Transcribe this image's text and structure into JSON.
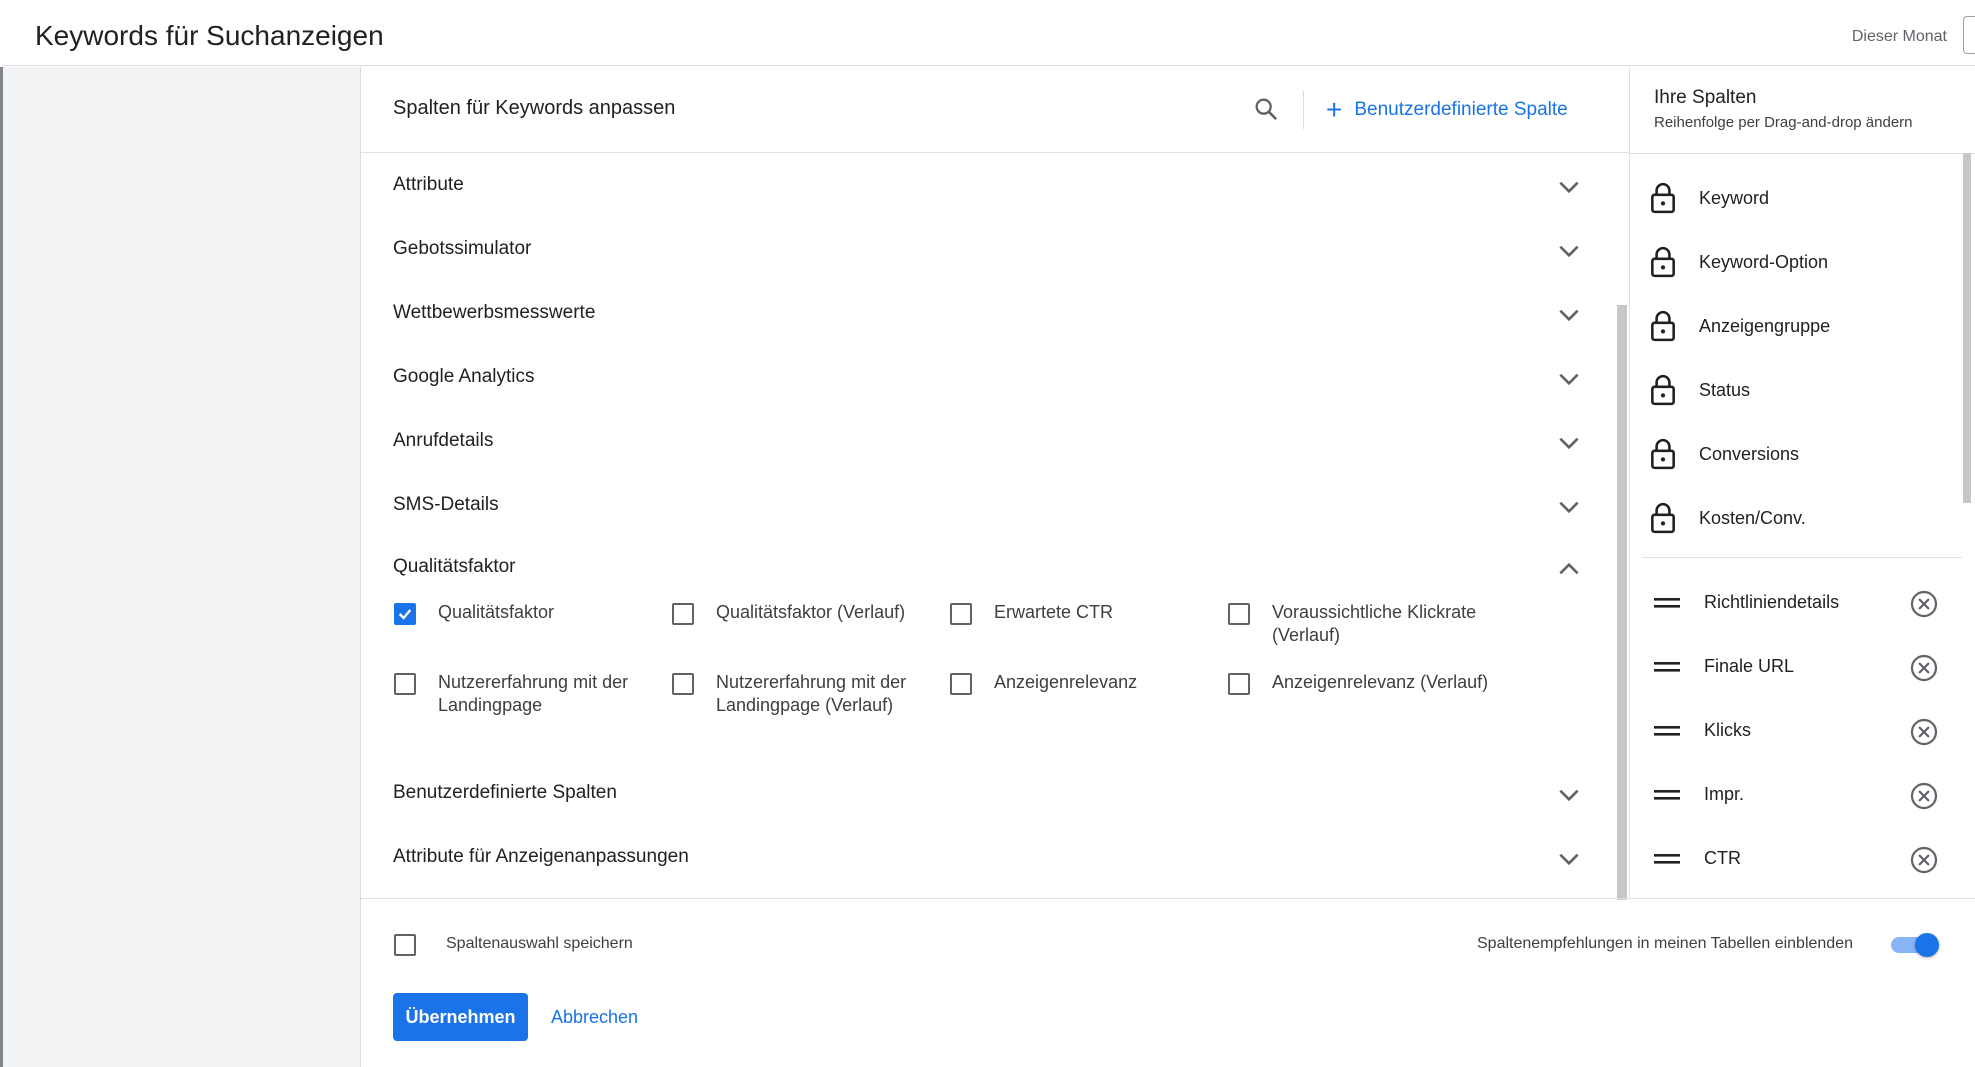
{
  "page": {
    "title": "Keywords für Suchanzeigen",
    "period_label": "Dieser Monat"
  },
  "dialog": {
    "title": "Spalten für Keywords anpassen",
    "custom_column_button": "Benutzerdefinierte Spalte",
    "sections": [
      {
        "label": "Attribute",
        "expanded": false
      },
      {
        "label": "Gebotssimulator",
        "expanded": false
      },
      {
        "label": "Wettbewerbsmesswerte",
        "expanded": false
      },
      {
        "label": "Google Analytics",
        "expanded": false
      },
      {
        "label": "Anrufdetails",
        "expanded": false
      },
      {
        "label": "SMS-Details",
        "expanded": false
      },
      {
        "label": "Qualitätsfaktor",
        "expanded": true
      },
      {
        "label": "Benutzerdefinierte Spalten",
        "expanded": false
      },
      {
        "label": "Attribute für Anzeigenanpassungen",
        "expanded": false
      }
    ],
    "quality_options": [
      {
        "label": "Qualitätsfaktor",
        "checked": true
      },
      {
        "label": "Qualitätsfaktor (Verlauf)",
        "checked": false
      },
      {
        "label": "Erwartete CTR",
        "checked": false
      },
      {
        "label": "Voraussichtliche Klickrate (Verlauf)",
        "checked": false
      },
      {
        "label": "Nutzererfahrung mit der Landingpage",
        "checked": false
      },
      {
        "label": "Nutzererfahrung mit der Landingpage (Verlauf)",
        "checked": false
      },
      {
        "label": "Anzeigenrelevanz",
        "checked": false
      },
      {
        "label": "Anzeigenrelevanz (Verlauf)",
        "checked": false
      }
    ]
  },
  "your_columns": {
    "title": "Ihre Spalten",
    "subtitle": "Reihenfolge per Drag-and-drop ändern",
    "locked": [
      "Keyword",
      "Keyword-Option",
      "Anzeigengruppe",
      "Status",
      "Conversions",
      "Kosten/Conv."
    ],
    "movable": [
      "Richtliniendetails",
      "Finale URL",
      "Klicks",
      "Impr.",
      "CTR"
    ]
  },
  "footer": {
    "save_selection_label": "Spaltenauswahl speichern",
    "save_selection_checked": false,
    "recommendations_label": "Spaltenempfehlungen in meinen Tabellen einblenden",
    "recommendations_on": true,
    "apply_label": "Übernehmen",
    "cancel_label": "Abbrechen"
  },
  "colors": {
    "accent": "#1a73e8",
    "text": "#202124",
    "divider": "#e0e0e0"
  }
}
